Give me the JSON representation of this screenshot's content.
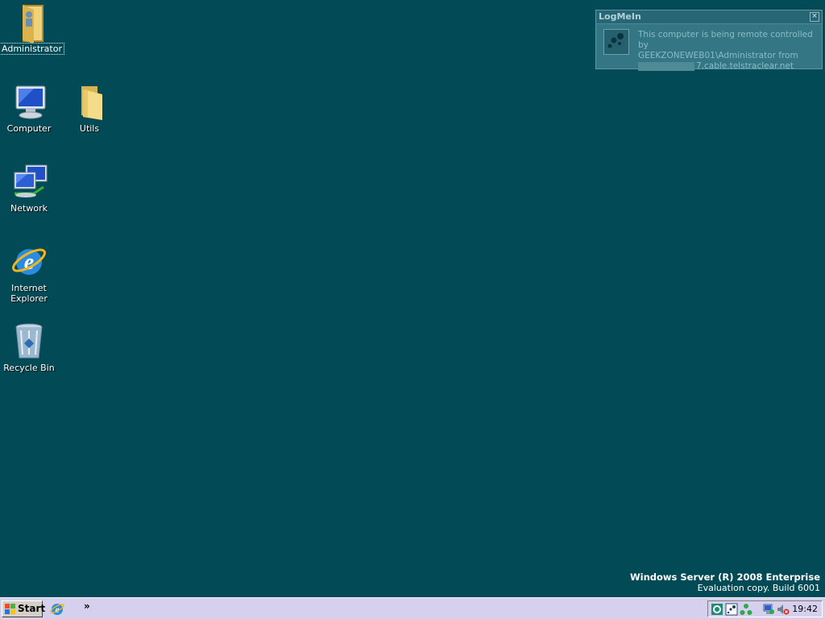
{
  "desktop": {
    "icons": [
      {
        "label": "Administrator",
        "icon": "user-folder-icon"
      },
      {
        "label": "Computer",
        "icon": "computer-icon"
      },
      {
        "label": "Utils",
        "icon": "folder-icon"
      },
      {
        "label": "Network",
        "icon": "network-icon"
      },
      {
        "label": "Internet Explorer",
        "icon": "internet-explorer-icon"
      },
      {
        "label": "Recycle Bin",
        "icon": "recycle-bin-icon"
      }
    ]
  },
  "notification": {
    "title": "LogMeIn",
    "line1": "This computer is being remote controlled by",
    "line2": "GEEKZONEWEB01\\Administrator from",
    "line3": "7.cable.telstraclear.net"
  },
  "watermark": {
    "edition": "Windows Server (R) 2008 Enterprise",
    "build": "Evaluation copy. Build 6001"
  },
  "taskbar": {
    "start_label": "Start",
    "quicklaunch_more": "»",
    "clock": "19:42"
  },
  "colors": {
    "desktop": "#024A55",
    "taskbar": "#D4D0EE"
  }
}
